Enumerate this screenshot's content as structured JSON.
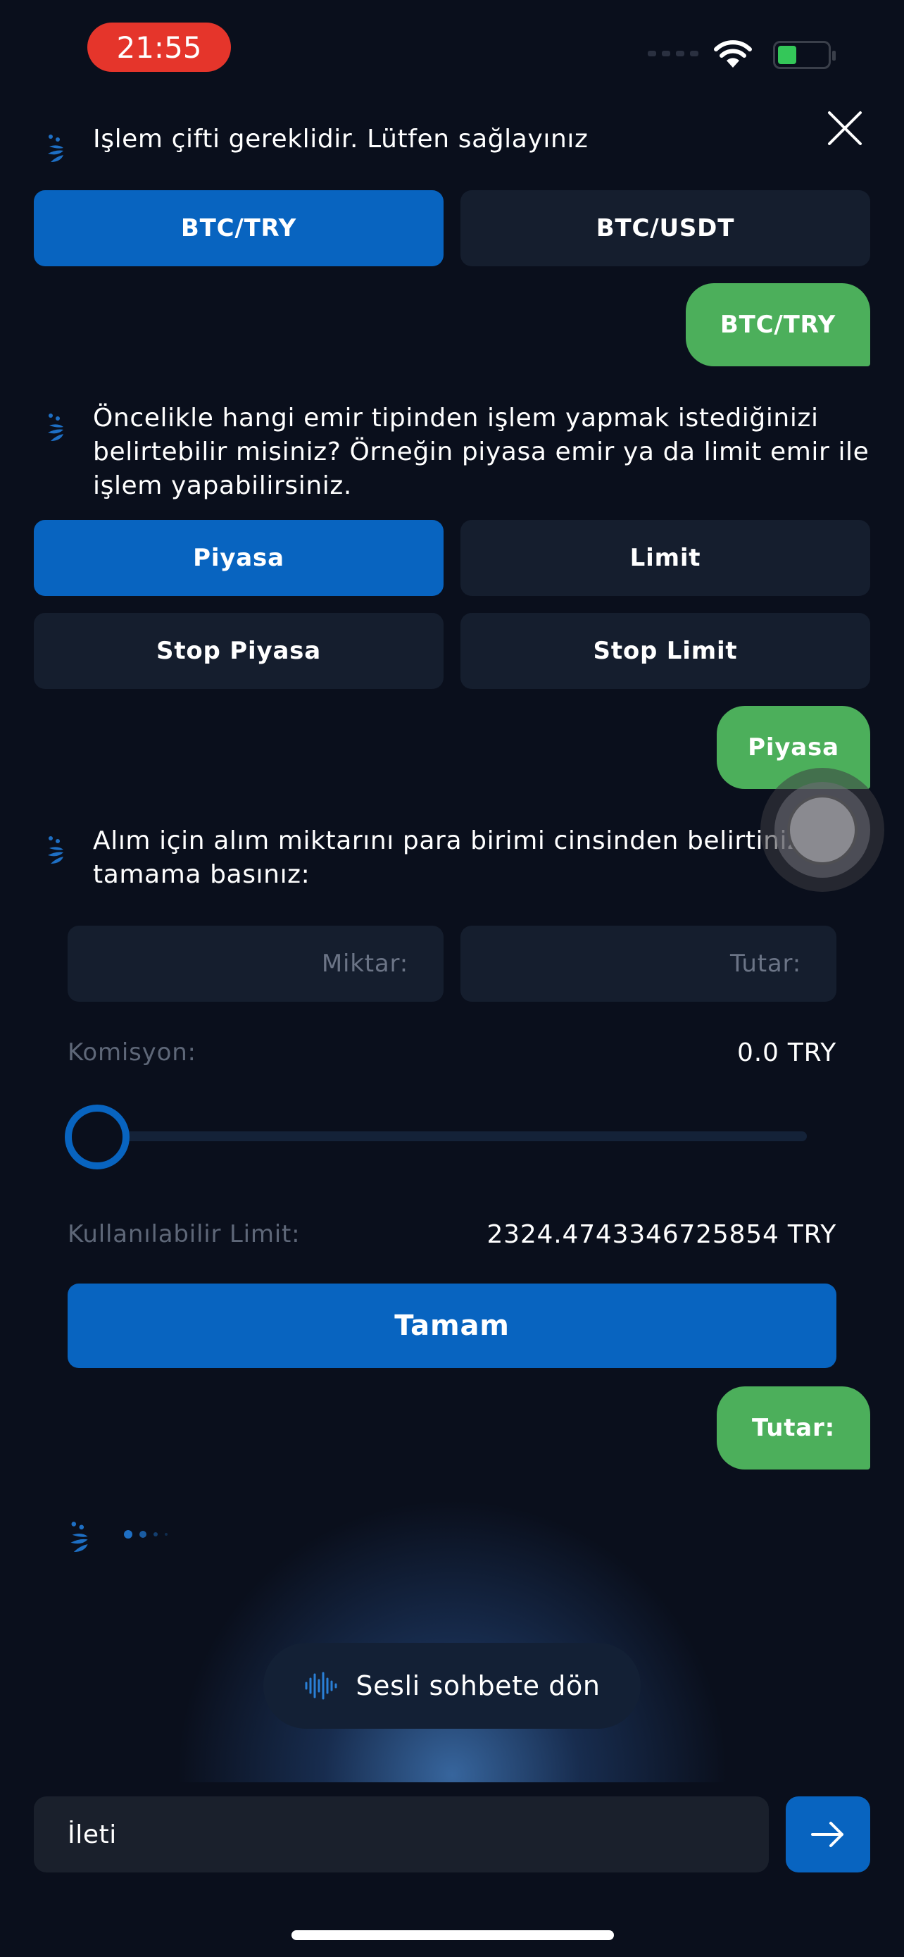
{
  "status_bar": {
    "time": "21:55"
  },
  "colors": {
    "accent": "#0864c0",
    "user_bubble": "#4caf5b",
    "background": "#0a0f1c",
    "option_bg": "#151e2e",
    "time_pill": "#e5352b"
  },
  "chat": {
    "msg1": {
      "text": "Işlem çifti gereklidir. Lütfen sağlayınız"
    },
    "pair_options": [
      "BTC/TRY",
      "BTC/USDT"
    ],
    "user_reply1": "BTC/TRY",
    "msg2": {
      "text": "Öncelikle hangi emir tipinden işlem yapmak istediğinizi belirtebilir misiniz? Örneğin piyasa emir ya da limit emir ile işlem yapabilirsiniz."
    },
    "order_options": [
      "Piyasa",
      "Limit",
      "Stop Piyasa",
      "Stop Limit"
    ],
    "user_reply2": "Piyasa",
    "msg3": {
      "text": "Alım için alım miktarını para birimi cinsinden belirtiniz ve tamama basınız:"
    },
    "form": {
      "amount_placeholder": "Miktar:",
      "total_placeholder": "Tutar:",
      "commission_label": "Komisyon:",
      "commission_value": "0.0 TRY",
      "slider_percent": 0,
      "available_label": "Kullanılabilir Limit:",
      "available_value": "2324.4743346725854 TRY",
      "submit_label": "Tamam"
    },
    "user_reply3": "Tutar:"
  },
  "voice_button": {
    "label": "Sesli sohbete dön",
    "icon": "waveform-icon"
  },
  "composer": {
    "placeholder": "İleti",
    "send_icon": "arrow-right-icon"
  }
}
